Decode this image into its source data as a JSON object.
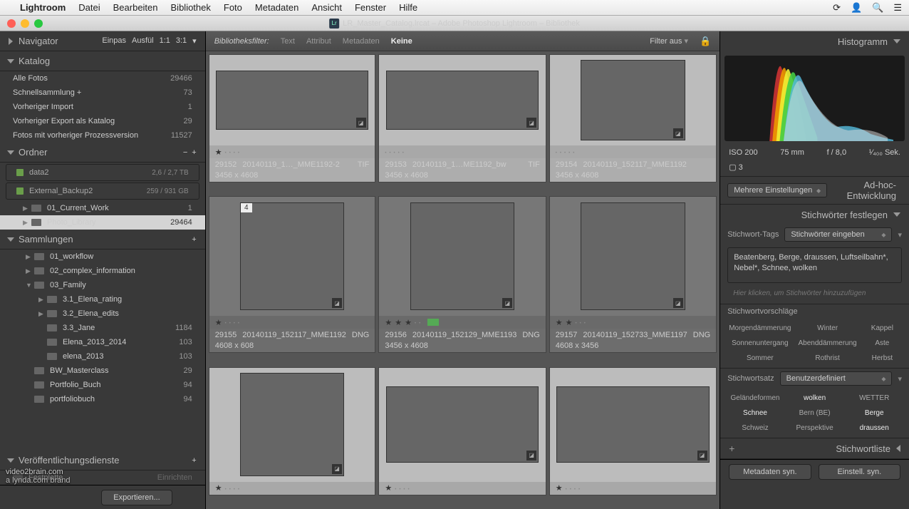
{
  "menubar": {
    "app": "Lightroom",
    "items": [
      "Datei",
      "Bearbeiten",
      "Bibliothek",
      "Foto",
      "Metadaten",
      "Ansicht",
      "Fenster",
      "Hilfe"
    ]
  },
  "title": "LR_Master_Catalog.lrcat – Adobe Photoshop Lightroom – Bibliothek",
  "left": {
    "navigator": {
      "label": "Navigator",
      "extras": [
        "Einpas",
        "Ausfül",
        "1:1",
        "3:1"
      ]
    },
    "katalog": {
      "label": "Katalog",
      "items": [
        {
          "label": "Alle Fotos",
          "count": "29466"
        },
        {
          "label": "Schnellsammlung  +",
          "count": "73"
        },
        {
          "label": "Vorheriger Import",
          "count": "1"
        },
        {
          "label": "Vorheriger Export als Katalog",
          "count": "29"
        },
        {
          "label": "Fotos mit vorheriger Prozessversion",
          "count": "11527"
        }
      ]
    },
    "ordner": {
      "label": "Ordner",
      "volumes": [
        {
          "name": "data2",
          "info": "2,6 / 2,7 TB"
        },
        {
          "name": "External_Backup2",
          "info": "259 / 931 GB"
        }
      ],
      "folders": [
        {
          "label": "01_Current_Work",
          "count": "1",
          "sel": false,
          "indent": 1
        },
        {
          "label": "Photo_Library",
          "count": "29464",
          "sel": true,
          "indent": 1
        }
      ]
    },
    "sammlungen": {
      "label": "Sammlungen",
      "items": [
        {
          "label": "01_workflow",
          "indent": 1,
          "arrow": true
        },
        {
          "label": "02_complex_information",
          "indent": 1,
          "arrow": true
        },
        {
          "label": "03_Family",
          "indent": 1,
          "arrow": true,
          "open": true
        },
        {
          "label": "3.1_Elena_rating",
          "indent": 2,
          "arrow": true
        },
        {
          "label": "3.2_Elena_edits",
          "indent": 2,
          "arrow": true
        },
        {
          "label": "3.3_Jane",
          "indent": 2,
          "count": "1184"
        },
        {
          "label": "Elena_2013_2014",
          "indent": 2,
          "count": "103"
        },
        {
          "label": "elena_2013",
          "indent": 2,
          "count": "103"
        },
        {
          "label": "BW_Masterclass",
          "indent": 1,
          "count": "29"
        },
        {
          "label": "Portfolio_Buch",
          "indent": 1,
          "count": "94"
        },
        {
          "label": "portfoliobuch",
          "indent": 1,
          "count": "94"
        }
      ]
    },
    "publish": {
      "label": "Veröffentlichungsdienste",
      "item": "Festplatte",
      "setup": "Einrichten"
    },
    "export_btn": "Exportieren..."
  },
  "filter": {
    "label": "Bibliotheksfilter:",
    "tabs": [
      "Text",
      "Attribut",
      "Metadaten",
      "Keine"
    ],
    "active": 3,
    "menu": "Filter aus"
  },
  "grid": [
    {
      "id": "29152",
      "name": "20140119_1…_MME1192-2",
      "dim": "3456 x 4608",
      "fmt": "TIF",
      "thumb": "sky wide",
      "stars": 1,
      "sel": true
    },
    {
      "id": "29153",
      "name": "20140119_1…ME1192_bw",
      "dim": "3456 x 4608",
      "fmt": "TIF",
      "thumb": "mtn wide",
      "stars": 0,
      "sel": true
    },
    {
      "id": "29154",
      "name": "20140119_152117_MME1192",
      "dim": "3456 x 4608",
      "fmt": "",
      "thumb": "sky tall",
      "stars": 0,
      "sel": true,
      "flag": "4",
      "row": "top"
    },
    {
      "id": "29155",
      "name": "20140119_152117_MME1192",
      "dim": "4608 x 608",
      "fmt": "DNG",
      "thumb": "skybw tall",
      "stars": 1,
      "sel": false,
      "flag": "4"
    },
    {
      "id": "29156",
      "name": "20140119_152129_MME1193",
      "dim": "3456 x 4608",
      "fmt": "DNG",
      "thumb": "skybw tall",
      "stars": 3,
      "sel": false,
      "color": true
    },
    {
      "id": "29157",
      "name": "20140119_152733_MME1197",
      "dim": "4608 x 3456",
      "fmt": "DNG",
      "thumb": "sky tall",
      "stars": 2,
      "sel": false
    },
    {
      "id": "",
      "name": "",
      "dim": "",
      "fmt": "",
      "thumb": "sky tall",
      "stars": 1,
      "sel": true,
      "mini": true
    },
    {
      "id": "",
      "name": "",
      "dim": "",
      "fmt": "",
      "thumb": "snow wide",
      "stars": 1,
      "sel": true,
      "mini": true
    },
    {
      "id": "",
      "name": "",
      "dim": "",
      "fmt": "",
      "thumb": "snow wide",
      "stars": 1,
      "sel": true,
      "mini": true
    }
  ],
  "right": {
    "histogram": {
      "label": "Histogramm",
      "meta": {
        "iso": "ISO 200",
        "focal": "75 mm",
        "aperture": "f / 8,0",
        "shutter": "¹⁄₄₀₀ Sek."
      }
    },
    "settings_sel": "Mehrere Einstellungen",
    "adhoc": "Ad-hoc-Entwicklung",
    "keywords": {
      "label": "Stichwörter festlegen",
      "tags_lbl": "Stichwort-Tags",
      "tags_sel": "Stichwörter eingeben",
      "text": "Beatenberg, Berge, draussen, Luftseilbahn*, Nebel*, Schnee, wolken",
      "hint": "Hier klicken, um Stichwörter hinzuzufügen"
    },
    "sugg": {
      "label": "Stichwortvorschläge",
      "items": [
        "Morgendämmerung",
        "Winter",
        "Kappel",
        "Sonnenuntergang",
        "Abenddämmerung",
        "Aste",
        "Sommer",
        "Rothrist",
        "Herbst"
      ]
    },
    "set": {
      "label": "Stichwortsatz",
      "sel": "Benutzerdefiniert",
      "items": [
        "Geländeformen",
        "wolken",
        "WETTER",
        "Schnee",
        "Bern (BE)",
        "Berge",
        "Schweiz",
        "Perspektive",
        "draussen"
      ],
      "on": [
        1,
        3,
        5,
        8
      ]
    },
    "kwlist": "Stichwortliste",
    "btn1": "Metadaten syn.",
    "btn2": "Einstell. syn."
  },
  "watermark": {
    "l1": "video2brain.com",
    "l2": "a lynda.com brand"
  }
}
